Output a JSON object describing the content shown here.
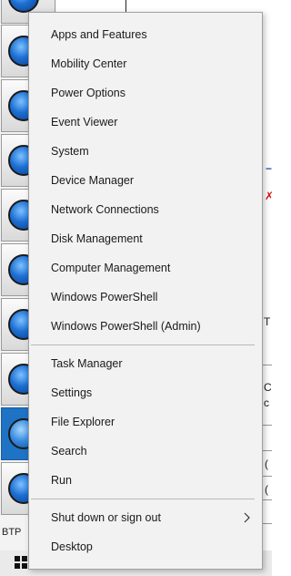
{
  "menu": {
    "group1": [
      {
        "label": "Apps and Features",
        "name": "menu-item-apps-and-features"
      },
      {
        "label": "Mobility Center",
        "name": "menu-item-mobility-center"
      },
      {
        "label": "Power Options",
        "name": "menu-item-power-options"
      },
      {
        "label": "Event Viewer",
        "name": "menu-item-event-viewer"
      },
      {
        "label": "System",
        "name": "menu-item-system"
      },
      {
        "label": "Device Manager",
        "name": "menu-item-device-manager"
      },
      {
        "label": "Network Connections",
        "name": "menu-item-network-connections"
      },
      {
        "label": "Disk Management",
        "name": "menu-item-disk-management"
      },
      {
        "label": "Computer Management",
        "name": "menu-item-computer-management"
      },
      {
        "label": "Windows PowerShell",
        "name": "menu-item-windows-powershell"
      },
      {
        "label": "Windows PowerShell (Admin)",
        "name": "menu-item-windows-powershell-admin"
      }
    ],
    "group2": [
      {
        "label": "Task Manager",
        "name": "menu-item-task-manager"
      },
      {
        "label": "Settings",
        "name": "menu-item-settings"
      },
      {
        "label": "File Explorer",
        "name": "menu-item-file-explorer"
      },
      {
        "label": "Search",
        "name": "menu-item-search"
      },
      {
        "label": "Run",
        "name": "menu-item-run"
      }
    ],
    "group3": [
      {
        "label": "Shut down or sign out",
        "name": "menu-item-shut-down-or-sign-out",
        "submenu_icon": "chevron-right-icon"
      },
      {
        "label": "Desktop",
        "name": "menu-item-desktop"
      }
    ]
  },
  "background": {
    "left_bottom_text": "BTP",
    "right_marks": [
      "T",
      "C",
      "c",
      "(",
      "("
    ],
    "start_icon": "windows-start-icon"
  },
  "colors": {
    "menu_background": "#f2f2f2",
    "menu_border": "#a0a0a0",
    "separator": "#b9b9b9",
    "selected_tile": "#1e73c4"
  }
}
